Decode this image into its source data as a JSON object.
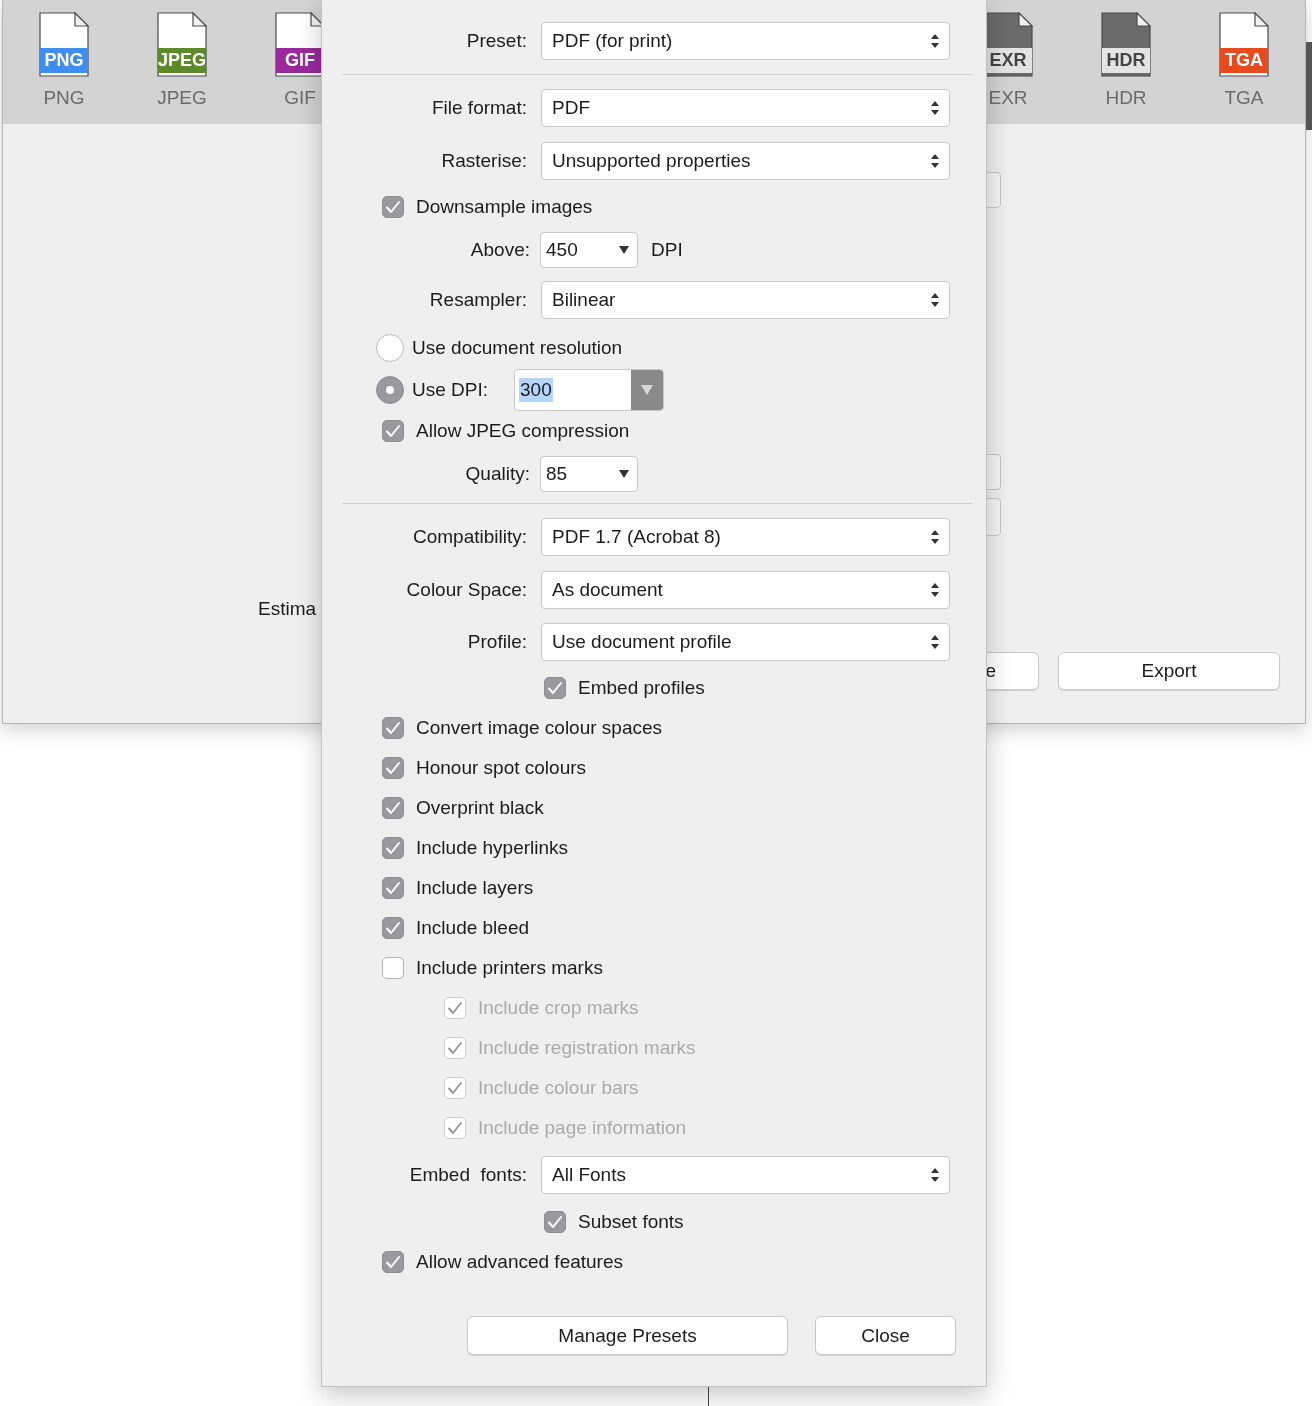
{
  "background_window": {
    "formats": [
      {
        "badge": "PNG",
        "label": "PNG",
        "color": "#3d8ef0",
        "kind": "light"
      },
      {
        "badge": "JPEG",
        "label": "JPEG",
        "color": "#5b8a27",
        "kind": "light"
      },
      {
        "badge": "GIF",
        "label": "GIF",
        "color": "#9a2a9c",
        "kind": "light"
      },
      {
        "badge": "EXR",
        "label": "EXR",
        "color": "#e4e4e4",
        "kind": "dark"
      },
      {
        "badge": "HDR",
        "label": "HDR",
        "color": "#e4e4e4",
        "kind": "dark"
      },
      {
        "badge": "TGA",
        "label": "TGA",
        "color": "#e8491d",
        "kind": "light"
      }
    ],
    "estimate_label": "Estima",
    "buttons": [
      "e",
      "Export"
    ]
  },
  "export_options": {
    "sections": [
      [
        {
          "kind": "select",
          "label": "Preset:",
          "value": "PDF (for print)"
        }
      ],
      [
        {
          "kind": "select",
          "label": "File format:",
          "value": "PDF"
        },
        {
          "kind": "select",
          "label": "Rasterise:",
          "value": "Unsupported properties"
        },
        {
          "kind": "checkbox",
          "label": "Downsample images",
          "checked": true,
          "disabled": false
        },
        {
          "kind": "number",
          "label": "Above:",
          "value": "450",
          "unit": "DPI"
        },
        {
          "kind": "select",
          "label": "Resampler:",
          "value": "Bilinear"
        },
        {
          "kind": "radio",
          "label": "Use document resolution",
          "selected": false
        },
        {
          "kind": "radio",
          "label": "Use DPI:",
          "selected": true,
          "value": "300"
        },
        {
          "kind": "checkbox",
          "label": "Allow JPEG compression",
          "checked": true,
          "disabled": false
        },
        {
          "kind": "number",
          "label": "Quality:",
          "value": "85"
        }
      ],
      [
        {
          "kind": "select",
          "label": "Compatibility:",
          "value": "PDF 1.7 (Acrobat 8)"
        },
        {
          "kind": "select",
          "label": "Colour Space:",
          "value": "As document"
        },
        {
          "kind": "select",
          "label": "Profile:",
          "value": "Use document profile",
          "children": [
            {
              "kind": "checkbox",
              "label": "Embed profiles",
              "checked": true,
              "disabled": false
            }
          ]
        },
        {
          "kind": "checkbox",
          "label": "Convert image colour spaces",
          "checked": true,
          "disabled": false
        },
        {
          "kind": "checkbox",
          "label": "Honour spot colours",
          "checked": true,
          "disabled": false
        },
        {
          "kind": "checkbox",
          "label": "Overprint black",
          "checked": true,
          "disabled": false
        },
        {
          "kind": "checkbox",
          "label": "Include hyperlinks",
          "checked": true,
          "disabled": false
        },
        {
          "kind": "checkbox",
          "label": "Include layers",
          "checked": true,
          "disabled": false
        },
        {
          "kind": "checkbox",
          "label": "Include bleed",
          "checked": true,
          "disabled": false
        },
        {
          "kind": "checkbox",
          "label": "Include printers marks",
          "checked": false,
          "disabled": false,
          "children": [
            {
              "kind": "checkbox",
              "label": "Include crop marks",
              "checked": true,
              "disabled": true
            },
            {
              "kind": "checkbox",
              "label": "Include registration marks",
              "checked": true,
              "disabled": true
            },
            {
              "kind": "checkbox",
              "label": "Include colour bars",
              "checked": true,
              "disabled": true
            },
            {
              "kind": "checkbox",
              "label": "Include page information",
              "checked": true,
              "disabled": true
            }
          ]
        },
        {
          "kind": "select",
          "label": "Embed  fonts:",
          "value": "All Fonts",
          "children": [
            {
              "kind": "checkbox",
              "label": "Subset fonts",
              "checked": true,
              "disabled": false
            }
          ]
        },
        {
          "kind": "checkbox",
          "label": "Allow advanced features",
          "checked": true,
          "disabled": false
        }
      ]
    ],
    "buttons": [
      "Manage Presets",
      "Close"
    ]
  }
}
